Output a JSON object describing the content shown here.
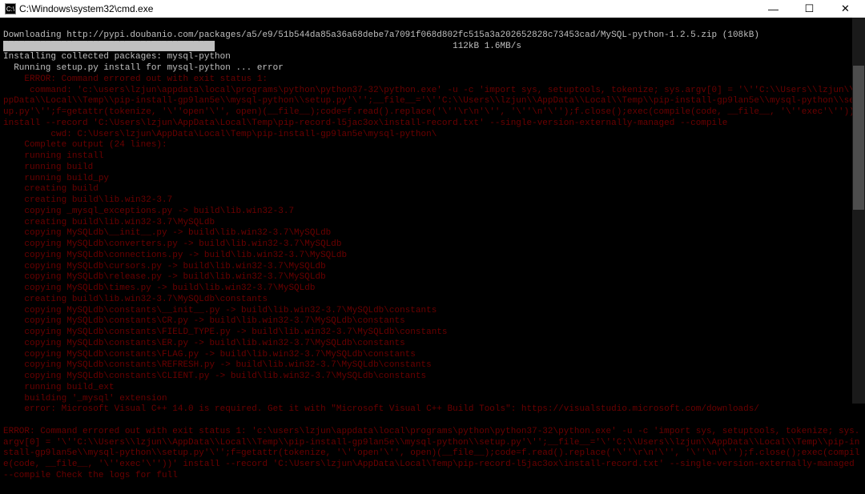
{
  "titlebar": {
    "icon_label": "C:\\",
    "title": "C:\\Windows\\system32\\cmd.exe",
    "min": "—",
    "max": "☐",
    "close": "✕"
  },
  "terminal": {
    "download_line": "Downloading http://pypi.doubanio.com/packages/a5/e9/51b544da85a36a68debe7a7091f068d802fc515a3a202652828c73453cad/MySQL-python-1.2.5.zip (108kB)",
    "progress_filled": "████████████████████████████████████████",
    "progress_empty": "                                            ",
    "progress_stats": " 112kB 1.6MB/s",
    "install_line": "Installing collected packages: mysql-python",
    "running_setup": "  Running setup.py install for mysql-python ... error",
    "error_lines": [
      "    ERROR: Command errored out with exit status 1:",
      "     command: 'c:\\users\\lzjun\\appdata\\local\\programs\\python\\python37-32\\python.exe' -u -c 'import sys, setuptools, tokenize; sys.argv[0] = '\\''C:\\\\Users\\\\lzjun\\\\AppData\\\\Local\\\\Temp\\\\pip-install-gp9lan5e\\\\mysql-python\\\\setup.py'\\'';__file__='\\''C:\\\\Users\\\\lzjun\\\\AppData\\\\Local\\\\Temp\\\\pip-install-gp9lan5e\\\\mysql-python\\\\setup.py'\\'';f=getattr(tokenize, '\\''open'\\'', open)(__file__);code=f.read().replace('\\''\\r\\n'\\'', '\\''\\n'\\'');f.close();exec(compile(code, __file__, '\\''exec'\\''))' install --record 'C:\\Users\\lzjun\\AppData\\Local\\Temp\\pip-record-l5jac3ox\\install-record.txt' --single-version-externally-managed --compile",
      "         cwd: C:\\Users\\lzjun\\AppData\\Local\\Temp\\pip-install-gp9lan5e\\mysql-python\\",
      "    Complete output (24 lines):",
      "    running install",
      "    running build",
      "    running build_py",
      "    creating build",
      "    creating build\\lib.win32-3.7",
      "    copying _mysql_exceptions.py -> build\\lib.win32-3.7",
      "    creating build\\lib.win32-3.7\\MySQLdb",
      "    copying MySQLdb\\__init__.py -> build\\lib.win32-3.7\\MySQLdb",
      "    copying MySQLdb\\converters.py -> build\\lib.win32-3.7\\MySQLdb",
      "    copying MySQLdb\\connections.py -> build\\lib.win32-3.7\\MySQLdb",
      "    copying MySQLdb\\cursors.py -> build\\lib.win32-3.7\\MySQLdb",
      "    copying MySQLdb\\release.py -> build\\lib.win32-3.7\\MySQLdb",
      "    copying MySQLdb\\times.py -> build\\lib.win32-3.7\\MySQLdb",
      "    creating build\\lib.win32-3.7\\MySQLdb\\constants",
      "    copying MySQLdb\\constants\\__init__.py -> build\\lib.win32-3.7\\MySQLdb\\constants",
      "    copying MySQLdb\\constants\\CR.py -> build\\lib.win32-3.7\\MySQLdb\\constants",
      "    copying MySQLdb\\constants\\FIELD_TYPE.py -> build\\lib.win32-3.7\\MySQLdb\\constants",
      "    copying MySQLdb\\constants\\ER.py -> build\\lib.win32-3.7\\MySQLdb\\constants",
      "    copying MySQLdb\\constants\\FLAG.py -> build\\lib.win32-3.7\\MySQLdb\\constants",
      "    copying MySQLdb\\constants\\REFRESH.py -> build\\lib.win32-3.7\\MySQLdb\\constants",
      "    copying MySQLdb\\constants\\CLIENT.py -> build\\lib.win32-3.7\\MySQLdb\\constants",
      "    running build_ext",
      "    building '_mysql' extension",
      "    error: Microsoft Visual C++ 14.0 is required. Get it with \"Microsoft Visual C++ Build Tools\": https://visualstudio.microsoft.com/downloads/",
      "",
      "ERROR: Command errored out with exit status 1: 'c:\\users\\lzjun\\appdata\\local\\programs\\python\\python37-32\\python.exe' -u -c 'import sys, setuptools, tokenize; sys.argv[0] = '\\''C:\\\\Users\\\\lzjun\\\\AppData\\\\Local\\\\Temp\\\\pip-install-gp9lan5e\\\\mysql-python\\\\setup.py'\\'';__file__='\\''C:\\\\Users\\\\lzjun\\\\AppData\\\\Local\\\\Temp\\\\pip-install-gp9lan5e\\\\mysql-python\\\\setup.py'\\'';f=getattr(tokenize, '\\''open'\\'', open)(__file__);code=f.read().replace('\\''\\r\\n'\\'', '\\''\\n'\\'');f.close();exec(compile(code, __file__, '\\''exec'\\''))' install --record 'C:\\Users\\lzjun\\AppData\\Local\\Temp\\pip-record-l5jac3ox\\install-record.txt' --single-version-externally-managed --compile Check the logs for full"
    ]
  }
}
